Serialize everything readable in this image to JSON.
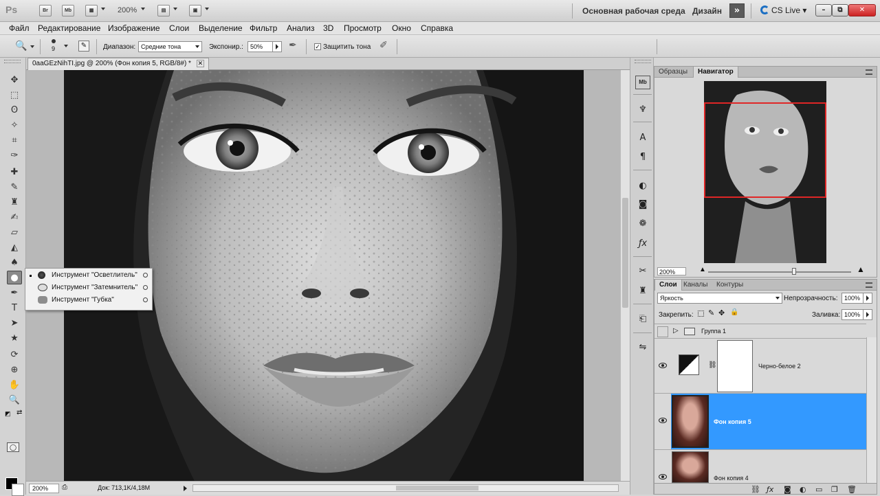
{
  "app": {
    "logo": "Ps",
    "bridge": "Br",
    "mini_bridge": "Mb",
    "zoom": "200%",
    "workspace": "Основная рабочая среда",
    "design": "Дизайн",
    "expand_glyph": "»",
    "cs_live": "CS Live",
    "minimize": "–",
    "restore": "⧉",
    "close": "✕"
  },
  "menu": [
    "Файл",
    "Редактирование",
    "Изображение",
    "Слои",
    "Выделение",
    "Фильтр",
    "Анализ",
    "3D",
    "Просмотр",
    "Окно",
    "Справка"
  ],
  "options": {
    "brush_size": "9",
    "range_label": "Диапазон:",
    "range_value": "Средние тона",
    "exposure_label": "Экспонир.:",
    "exposure_value": "50%",
    "protect_label": "Защитить тона",
    "protect_checked": "✓"
  },
  "document": {
    "tab_title": "0aaGEzNihTI.jpg @ 200% (Фон копия 5, RGB/8#) *",
    "tab_close": "✕"
  },
  "status": {
    "zoom": "200%",
    "doc_info": "Док: 713,1K/4,18M"
  },
  "tool_flyout": [
    {
      "label": "Инструмент \"Осветлитель\"",
      "selected": true
    },
    {
      "label": "Инструмент \"Затемнитель\"",
      "selected": false
    },
    {
      "label": "Инструмент \"Губка\"",
      "selected": false
    }
  ],
  "navigator": {
    "tabs": [
      "Образцы",
      "Навигатор"
    ],
    "active_tab": "Навигатор",
    "zoom": "200%"
  },
  "layers": {
    "tabs": [
      "Слои",
      "Каналы",
      "Контуры"
    ],
    "blend_mode": "Яркость",
    "opacity_label": "Непрозрачность:",
    "opacity_value": "100%",
    "lock_label": "Закрепить:",
    "fill_label": "Заливка:",
    "fill_value": "100%",
    "items": [
      {
        "name": "Группа 1",
        "type": "group",
        "visible": false
      },
      {
        "name": "Черно-белое 2",
        "type": "adjustment",
        "visible": true
      },
      {
        "name": "Фон копия 5",
        "type": "pixel",
        "visible": true,
        "selected": true
      },
      {
        "name": "Фон копия 4",
        "type": "pixel",
        "visible": true
      }
    ]
  },
  "colors": {
    "selection_blue": "#3399ff",
    "navigator_frame": "#e02626"
  }
}
